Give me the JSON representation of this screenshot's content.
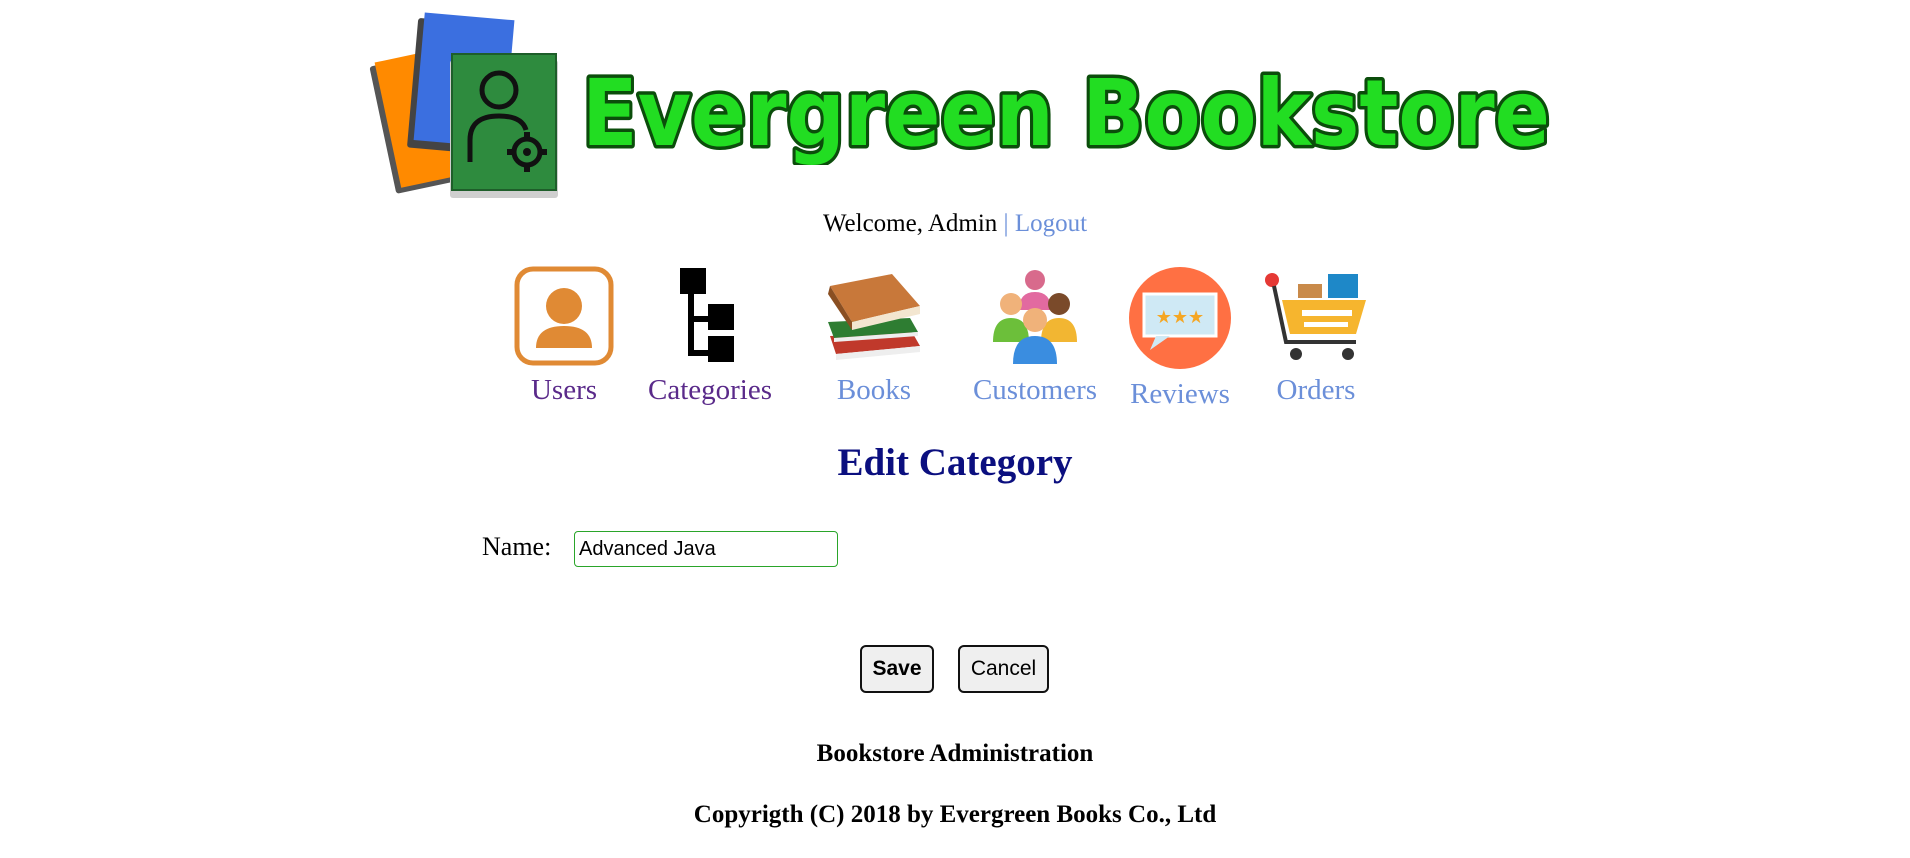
{
  "header": {
    "brand": "Evergreen Bookstore",
    "welcome_text": "Welcome, Admin",
    "separator": "|",
    "logout_label": "Logout"
  },
  "nav": {
    "items": [
      {
        "label": "Users",
        "icon": "user-icon",
        "state": "visited"
      },
      {
        "label": "Categories",
        "icon": "category-tree-icon",
        "state": "visited"
      },
      {
        "label": "Books",
        "icon": "books-icon",
        "state": "unvisited"
      },
      {
        "label": "Customers",
        "icon": "customers-icon",
        "state": "unvisited"
      },
      {
        "label": "Reviews",
        "icon": "reviews-icon",
        "state": "unvisited"
      },
      {
        "label": "Orders",
        "icon": "shopping-cart-icon",
        "state": "unvisited"
      }
    ]
  },
  "main": {
    "title": "Edit Category",
    "form": {
      "name_label": "Name:",
      "name_value": "Advanced Java",
      "save_label": "Save",
      "cancel_label": "Cancel"
    }
  },
  "footer": {
    "line1": "Bookstore Administration",
    "line2": "Copyrigth (C) 2018 by Evergreen Books Co., Ltd"
  },
  "colors": {
    "brand_green": "#22dd22",
    "brand_outline": "#0b4d0b",
    "title_navy": "#0b0f7f",
    "link_blue": "#6b8fd9",
    "visited_purple": "#5a2a8a"
  }
}
